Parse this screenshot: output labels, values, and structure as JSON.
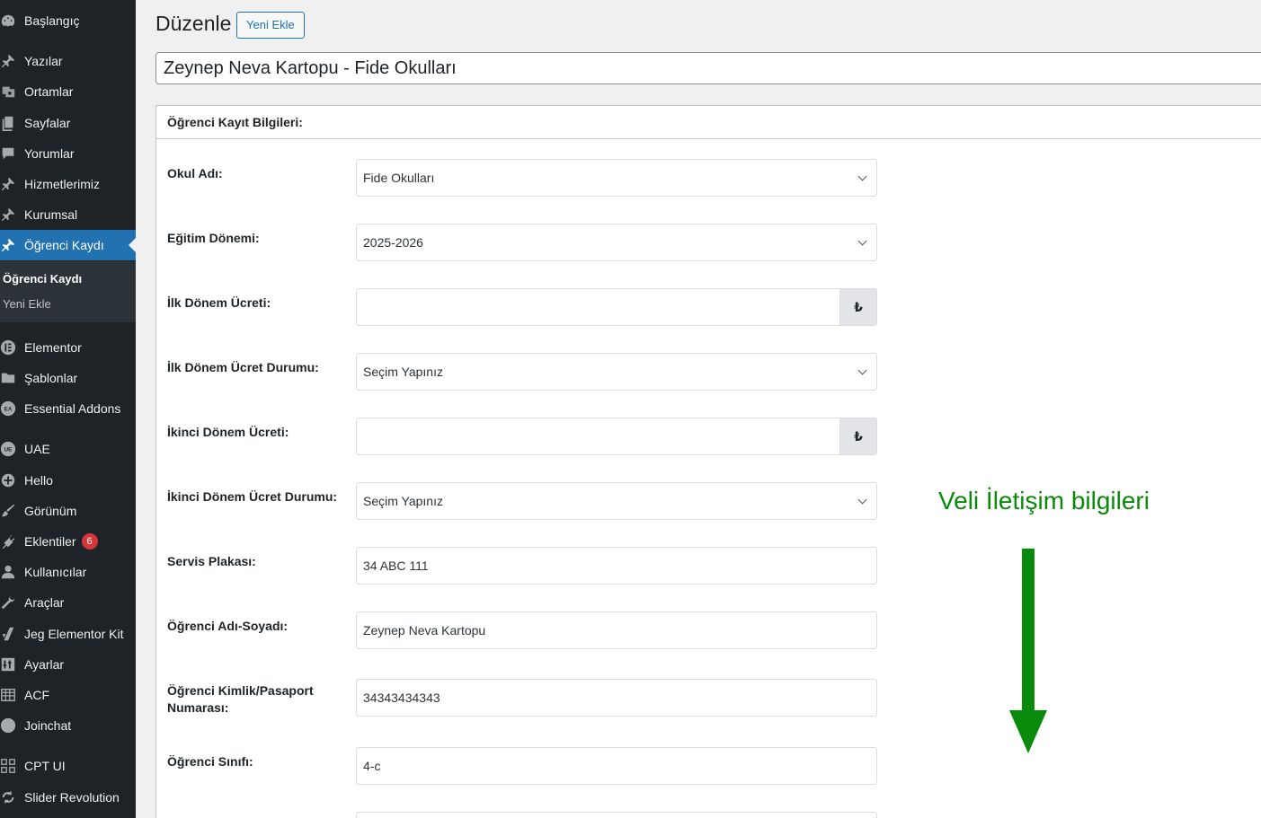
{
  "sidebar": {
    "items": [
      {
        "label": "Başlangıç",
        "icon": "dashboard-icon"
      },
      {
        "label": "Yazılar",
        "icon": "pin-icon"
      },
      {
        "label": "Ortamlar",
        "icon": "media-icon"
      },
      {
        "label": "Sayfalar",
        "icon": "pages-icon"
      },
      {
        "label": "Yorumlar",
        "icon": "comment-icon"
      },
      {
        "label": "Hizmetlerimiz",
        "icon": "pin-icon"
      },
      {
        "label": "Kurumsal",
        "icon": "pin-icon"
      },
      {
        "label": "Öğrenci Kaydı",
        "icon": "pin-icon"
      },
      {
        "label": "Elementor",
        "icon": "elementor-icon"
      },
      {
        "label": "Şablonlar",
        "icon": "folder-icon"
      },
      {
        "label": "Essential Addons",
        "icon": "ea-icon"
      },
      {
        "label": "UAE",
        "icon": "uae-icon"
      },
      {
        "label": "Hello",
        "icon": "plus-circle-icon"
      },
      {
        "label": "Görünüm",
        "icon": "brush-icon"
      },
      {
        "label": "Eklentiler",
        "icon": "plugin-icon"
      },
      {
        "label": "Kullanıcılar",
        "icon": "user-icon"
      },
      {
        "label": "Araçlar",
        "icon": "wrench-icon"
      },
      {
        "label": "Jeg Elementor Kit",
        "icon": "jeg-icon"
      },
      {
        "label": "Ayarlar",
        "icon": "settings-icon"
      },
      {
        "label": "ACF",
        "icon": "acf-icon"
      },
      {
        "label": "Joinchat",
        "icon": "chat-icon"
      },
      {
        "label": "CPT UI",
        "icon": "grid-icon"
      },
      {
        "label": "Slider Revolution",
        "icon": "refresh-icon"
      }
    ],
    "plugins_badge": "6",
    "submenu": {
      "current": "Öğrenci Kaydı",
      "add_new": "Yeni Ekle"
    }
  },
  "header": {
    "title": "Düzenle",
    "add_new": "Yeni Ekle"
  },
  "post_title": "Zeynep Neva Kartopu - Fide Okulları",
  "postbox": {
    "title": "Öğrenci Kayıt Bilgileri:",
    "fields": [
      {
        "label": "Okul Adı:",
        "value": "Fide Okulları"
      },
      {
        "label": "Eğitim Dönemi:",
        "value": "2025-2026"
      },
      {
        "label": "İlk Dönem Ücreti:",
        "value": "",
        "append": "₺"
      },
      {
        "label": "İlk Dönem Ücret Durumu:",
        "value": "Seçim Yapınız"
      },
      {
        "label": "İkinci Dönem Ücreti:",
        "value": "",
        "append": "₺"
      },
      {
        "label": "İkinci Dönem Ücret Durumu:",
        "value": "Seçim Yapınız"
      },
      {
        "label": "Servis Plakası:",
        "value": "34 ABC 111"
      },
      {
        "label": "Öğrenci Adı-Soyadı:",
        "value": "Zeynep Neva Kartopu"
      },
      {
        "label": "Öğrenci Kimlik/Pasaport Numarası:",
        "value": "34343434343"
      },
      {
        "label": "Öğrenci Sınıfı:",
        "value": "4-c"
      }
    ]
  },
  "annotation": {
    "text": "Veli İletişim bilgileri",
    "color": "#0a8a0a"
  }
}
